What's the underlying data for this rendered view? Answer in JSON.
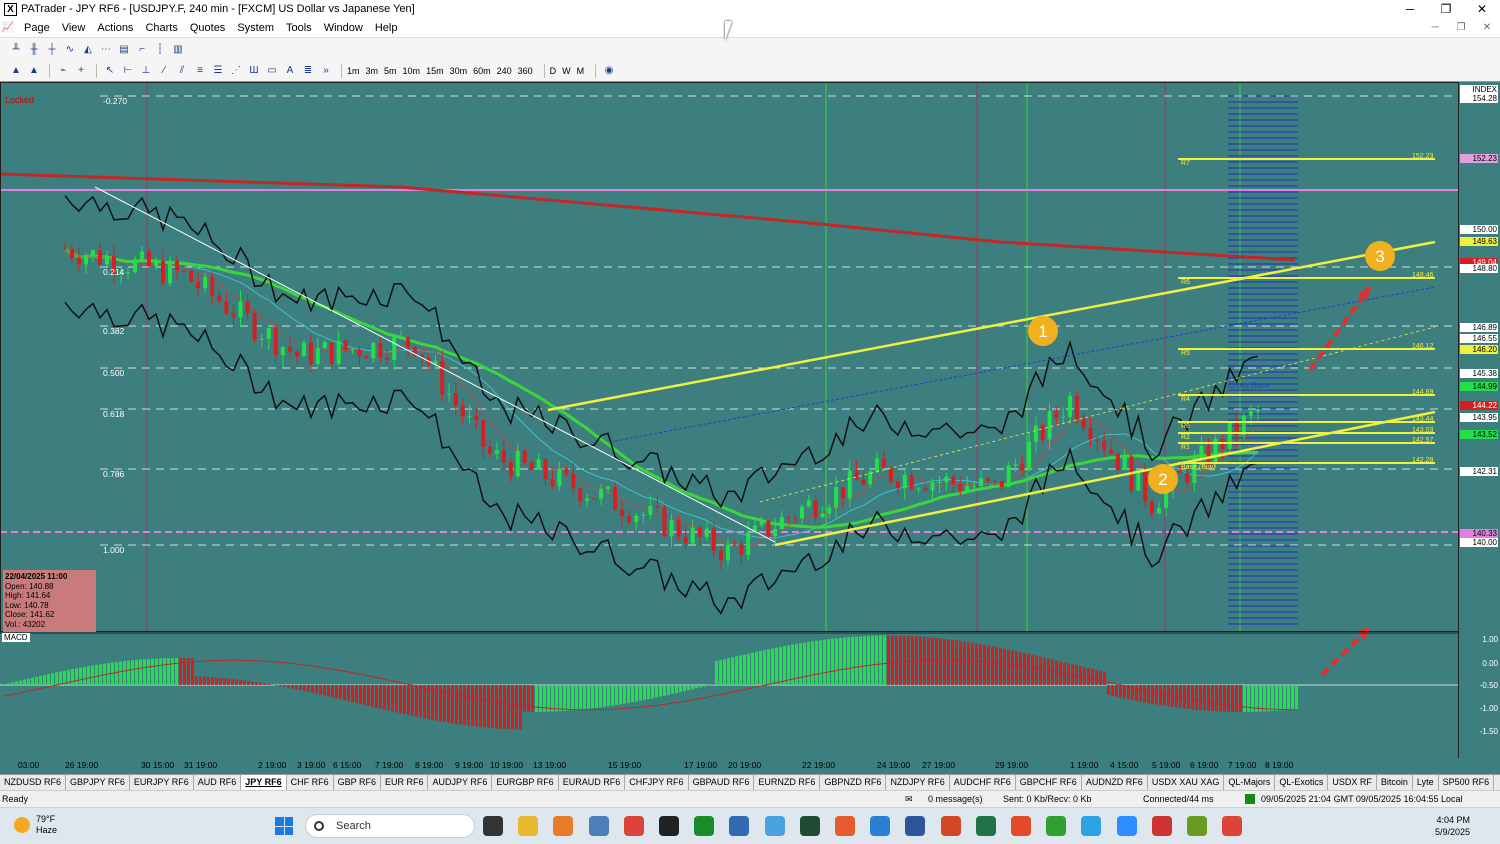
{
  "window": {
    "title": "PATrader - JPY RF6 - [USDJPY.F, 240 min - [FXCM] US Dollar vs Japanese Yen]",
    "app_icon": "X",
    "min": "─",
    "max": "❐",
    "close": "✕"
  },
  "menu": [
    "Page",
    "View",
    "Actions",
    "Charts",
    "Quotes",
    "System",
    "Tools",
    "Window",
    "Help"
  ],
  "timeframes": [
    "1m",
    "3m",
    "5m",
    "10m",
    "15m",
    "30m",
    "60m",
    "240",
    "360",
    "D",
    "W",
    "M"
  ],
  "chart": {
    "locked": "Locked",
    "fib_levels": [
      "-0.270",
      "0.214",
      "0.382",
      "0.500",
      "0.618",
      "0.786",
      "1.000"
    ],
    "info": {
      "date": "22/04/2025 11:00",
      "open": "Open: 140.88",
      "high": "High: 141.64",
      "low": "Low: 140.78",
      "close": "Close: 141.62",
      "vol": "Vol.: 43202"
    },
    "macd_label": "MACD",
    "price_axis": [
      "INDEX",
      "154.28",
      "152.23",
      "150.00",
      "149.63",
      "149.04",
      "148.80",
      "146.89",
      "146.55",
      "146.20",
      "145.38",
      "144.99",
      "144.22",
      "143.95",
      "143.52",
      "142.31",
      "140.33",
      "140.00"
    ],
    "macd_axis": [
      "1.00",
      "0.00",
      "-0.50",
      "-1.00",
      "-1.50"
    ],
    "time_labels": [
      "03:00",
      "26 19:00",
      "30 15:00",
      "31 19:00",
      "2 19:00",
      "3 19:00",
      "6 15:00",
      "7 19:00",
      "8 19:00",
      "9 19:00",
      "10 19:00",
      "13 19:00",
      "15 19:00",
      "17 19:00",
      "20 19:00",
      "22 19:00",
      "24 19:00",
      "27 19:00",
      "29 19:00",
      "1 19:00",
      "4 15:00",
      "5 19:00",
      "6 19:00",
      "7 19:00",
      "8 19:00"
    ],
    "pivot_labels": [
      "R7",
      "R6",
      "R5",
      "R4",
      "R3",
      "R2",
      "R1",
      "Base (Buy)"
    ],
    "pivot_values": [
      "152.23",
      "148.46",
      "146.12",
      "144.69",
      "143.44",
      "143.03",
      "142.57",
      "142.28"
    ],
    "markers": [
      "1",
      "2",
      "3"
    ],
    "cross_base": "Cross Base",
    "colors": {
      "bg": "#3c7f7e",
      "bull": "#22e04a",
      "bear": "#d42020",
      "trend": "#f0f040",
      "ma_red": "#c02828",
      "ma_green": "#3bd63b"
    }
  },
  "chart_data": {
    "type": "candlestick",
    "title": "USDJPY.F, 240 min",
    "ylim": [
      138.5,
      155
    ],
    "x": [
      "26 19:00",
      "31 19:00",
      "3 19:00",
      "8 19:00",
      "10 19:00",
      "15 19:00",
      "20 19:00",
      "22 19:00",
      "24 19:00",
      "29 19:00",
      "1 19:00",
      "5 19:00",
      "8 19:00"
    ],
    "close": [
      150.0,
      149.2,
      146.8,
      147.2,
      143.8,
      142.5,
      140.9,
      142.2,
      143.3,
      142.8,
      145.5,
      142.4,
      145.3
    ]
  },
  "tabs": [
    "NZDUSD RF6",
    "GBPJPY RF6",
    "EURJPY RF6",
    "AUD RF6",
    "JPY RF6",
    "CHF RF6",
    "GBP RF6",
    "EUR RF6",
    "AUDJPY RF6",
    "EURGBP RF6",
    "EURAUD RF6",
    "CHFJPY RF6",
    "GBPAUD RF6",
    "EURNZD RF6",
    "GBPNZD RF6",
    "NZDJPY RF6",
    "AUDCHF RF6",
    "GBPCHF RF6",
    "AUDNZD RF6",
    "USDX XAU XAG",
    "QL-Majors",
    "QL-Exotics",
    "USDX RF",
    "Bitcoin",
    "Lyte",
    "SP500 RF6"
  ],
  "active_tab": "JPY RF6",
  "status": {
    "ready": "Ready",
    "messages": "0 message(s)",
    "sent": "Sent: 0 Kb/Recv: 0 Kb",
    "connected": "Connected/44 ms",
    "time": "09/05/2025 21:04 GMT  09/05/2025 16:04:55 Local"
  },
  "taskbar": {
    "temp": "79°F",
    "cond": "Haze",
    "search": "Search",
    "time": "4:04 PM",
    "date": "5/9/2025"
  }
}
